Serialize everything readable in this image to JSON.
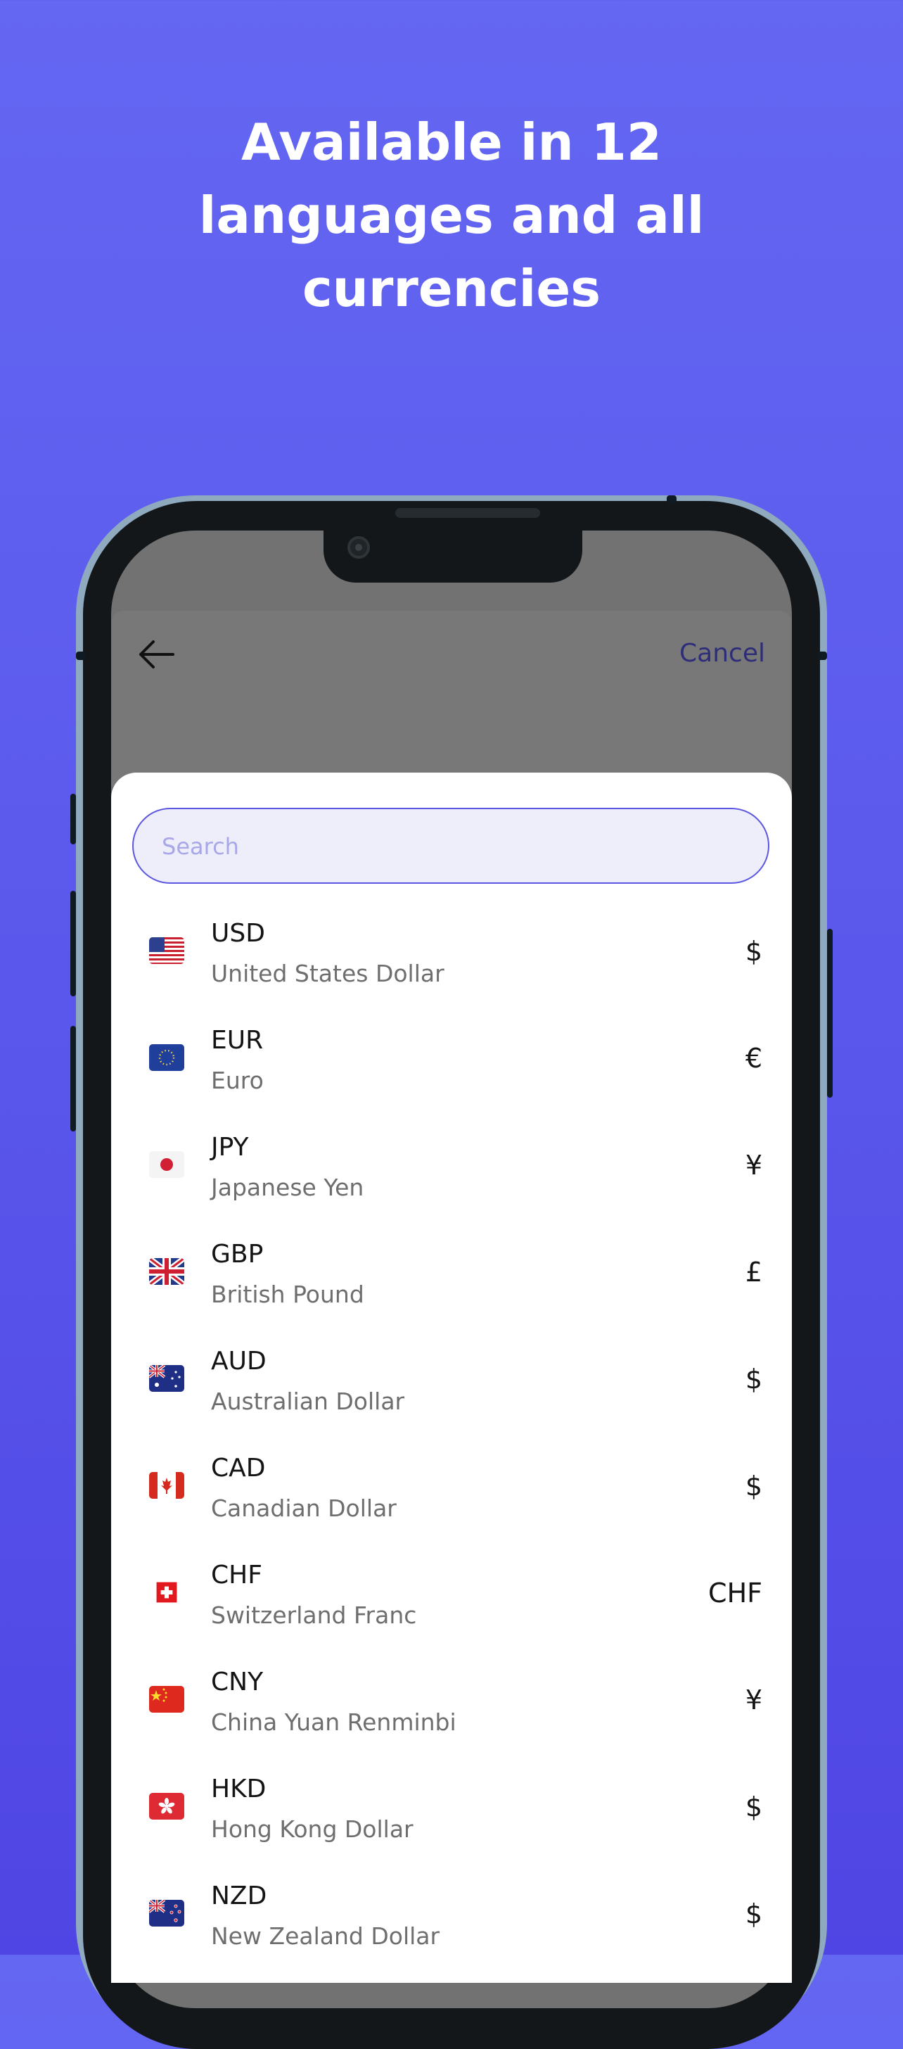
{
  "headline": {
    "line1": "Available in 12",
    "line2": "languages and all",
    "line3": "currencies"
  },
  "colors": {
    "background_top": "#6467f2",
    "background_bottom": "#4f45e4",
    "accent": "#5b57e0",
    "cancel": "#2e2d7a"
  },
  "topbar": {
    "back_icon": "arrow-left-icon",
    "cancel_label": "Cancel"
  },
  "search": {
    "placeholder": "Search"
  },
  "currencies": [
    {
      "code": "USD",
      "name": "United States Dollar",
      "symbol": "$",
      "flag": "us-flag-icon"
    },
    {
      "code": "EUR",
      "name": "Euro",
      "symbol": "€",
      "flag": "eu-flag-icon"
    },
    {
      "code": "JPY",
      "name": "Japanese Yen",
      "symbol": "¥",
      "flag": "jp-flag-icon"
    },
    {
      "code": "GBP",
      "name": "British Pound",
      "symbol": "£",
      "flag": "gb-flag-icon"
    },
    {
      "code": "AUD",
      "name": "Australian Dollar",
      "symbol": "$",
      "flag": "au-flag-icon"
    },
    {
      "code": "CAD",
      "name": "Canadian Dollar",
      "symbol": "$",
      "flag": "ca-flag-icon"
    },
    {
      "code": "CHF",
      "name": "Switzerland Franc",
      "symbol": "CHF",
      "flag": "ch-flag-icon"
    },
    {
      "code": "CNY",
      "name": "China Yuan Renminbi",
      "symbol": "¥",
      "flag": "cn-flag-icon"
    },
    {
      "code": "HKD",
      "name": "Hong Kong Dollar",
      "symbol": "$",
      "flag": "hk-flag-icon"
    },
    {
      "code": "NZD",
      "name": "New Zealand Dollar",
      "symbol": "$",
      "flag": "nz-flag-icon"
    }
  ]
}
